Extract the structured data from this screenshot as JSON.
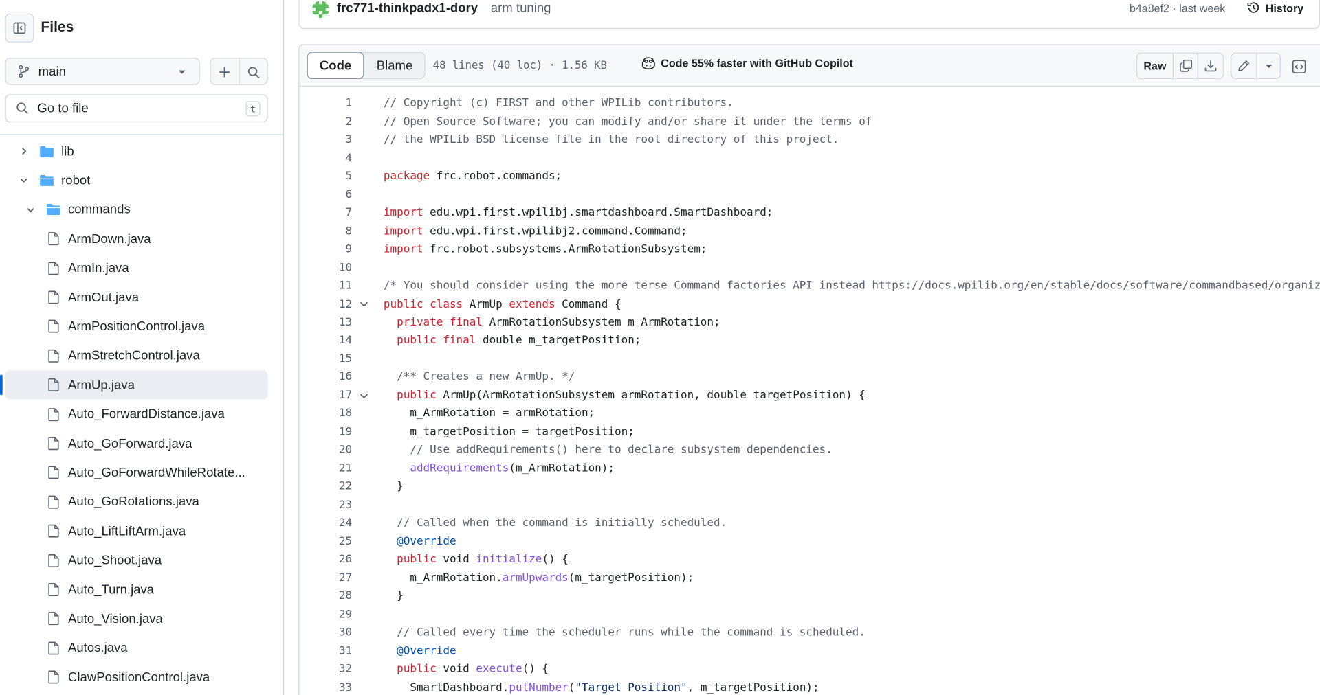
{
  "sidebar": {
    "title": "Files",
    "branch": "main",
    "search_placeholder": "Go to file",
    "search_shortcut": "t",
    "tree": [
      {
        "name": "lib",
        "type": "folder",
        "expanded": false,
        "depth": 0
      },
      {
        "name": "robot",
        "type": "folder",
        "expanded": true,
        "depth": 0
      },
      {
        "name": "commands",
        "type": "folder",
        "expanded": true,
        "depth": 1
      },
      {
        "name": "ArmDown.java",
        "type": "file",
        "depth": 2
      },
      {
        "name": "ArmIn.java",
        "type": "file",
        "depth": 2
      },
      {
        "name": "ArmOut.java",
        "type": "file",
        "depth": 2
      },
      {
        "name": "ArmPositionControl.java",
        "type": "file",
        "depth": 2
      },
      {
        "name": "ArmStretchControl.java",
        "type": "file",
        "depth": 2
      },
      {
        "name": "ArmUp.java",
        "type": "file",
        "depth": 2,
        "active": true
      },
      {
        "name": "Auto_ForwardDistance.java",
        "type": "file",
        "depth": 2
      },
      {
        "name": "Auto_GoForward.java",
        "type": "file",
        "depth": 2
      },
      {
        "name": "Auto_GoForwardWhileRotate...",
        "type": "file",
        "depth": 2
      },
      {
        "name": "Auto_GoRotations.java",
        "type": "file",
        "depth": 2
      },
      {
        "name": "Auto_LiftLiftArm.java",
        "type": "file",
        "depth": 2
      },
      {
        "name": "Auto_Shoot.java",
        "type": "file",
        "depth": 2
      },
      {
        "name": "Auto_Turn.java",
        "type": "file",
        "depth": 2
      },
      {
        "name": "Auto_Vision.java",
        "type": "file",
        "depth": 2
      },
      {
        "name": "Autos.java",
        "type": "file",
        "depth": 2
      },
      {
        "name": "ClawPositionControl.java",
        "type": "file",
        "depth": 2
      }
    ]
  },
  "commit": {
    "author": "frc771-thinkpadx1-dory",
    "message": "arm tuning",
    "hash_time": "b4a8ef2 · last week",
    "history_label": "History"
  },
  "file_header": {
    "tab_code": "Code",
    "tab_blame": "Blame",
    "meta": "48 lines (40 loc) · 1.56 KB",
    "copilot_text": "Code 55% faster with GitHub Copilot",
    "raw_label": "Raw"
  },
  "code_lines": [
    {
      "n": "1",
      "tokens": [
        [
          "cm",
          "// Copyright (c) FIRST and other WPILib contributors."
        ]
      ]
    },
    {
      "n": "2",
      "tokens": [
        [
          "cm",
          "// Open Source Software; you can modify and/or share it under the terms of"
        ]
      ]
    },
    {
      "n": "3",
      "tokens": [
        [
          "cm",
          "// the WPILib BSD license file in the root directory of this project."
        ]
      ]
    },
    {
      "n": "4",
      "tokens": []
    },
    {
      "n": "5",
      "tokens": [
        [
          "kw",
          "package"
        ],
        [
          "",
          " frc.robot.commands;"
        ]
      ]
    },
    {
      "n": "6",
      "tokens": []
    },
    {
      "n": "7",
      "tokens": [
        [
          "kw",
          "import"
        ],
        [
          "",
          " edu.wpi.first.wpilibj.smartdashboard.SmartDashboard;"
        ]
      ]
    },
    {
      "n": "8",
      "tokens": [
        [
          "kw",
          "import"
        ],
        [
          "",
          " edu.wpi.first.wpilibj2.command.Command;"
        ]
      ]
    },
    {
      "n": "9",
      "tokens": [
        [
          "kw",
          "import"
        ],
        [
          "",
          " frc.robot.subsystems.ArmRotationSubsystem;"
        ]
      ]
    },
    {
      "n": "10",
      "tokens": []
    },
    {
      "n": "11",
      "tokens": [
        [
          "cm",
          "/* You should consider using the more terse Command factories API instead https://docs.wpilib.org/en/stable/docs/software/commandbased/organizi"
        ]
      ]
    },
    {
      "n": "12",
      "fold": true,
      "tokens": [
        [
          "kw",
          "public class"
        ],
        [
          "",
          " ArmUp "
        ],
        [
          "kw",
          "extends"
        ],
        [
          "",
          " Command {"
        ]
      ]
    },
    {
      "n": "13",
      "tokens": [
        [
          "",
          "  "
        ],
        [
          "kw",
          "private final"
        ],
        [
          "",
          " ArmRotationSubsystem m_ArmRotation;"
        ]
      ]
    },
    {
      "n": "14",
      "tokens": [
        [
          "",
          "  "
        ],
        [
          "kw",
          "public final"
        ],
        [
          "",
          " double m_targetPosition;"
        ]
      ]
    },
    {
      "n": "15",
      "tokens": []
    },
    {
      "n": "16",
      "tokens": [
        [
          "",
          "  "
        ],
        [
          "cm",
          "/** Creates a new ArmUp. */"
        ]
      ]
    },
    {
      "n": "17",
      "fold": true,
      "tokens": [
        [
          "",
          "  "
        ],
        [
          "kw",
          "public"
        ],
        [
          "",
          " ArmUp(ArmRotationSubsystem armRotation, double targetPosition) {"
        ]
      ]
    },
    {
      "n": "18",
      "tokens": [
        [
          "",
          "    m_ArmRotation = armRotation;"
        ]
      ]
    },
    {
      "n": "19",
      "tokens": [
        [
          "",
          "    m_targetPosition = targetPosition;"
        ]
      ]
    },
    {
      "n": "20",
      "tokens": [
        [
          "",
          "    "
        ],
        [
          "cm",
          "// Use addRequirements() here to declare subsystem dependencies."
        ]
      ]
    },
    {
      "n": "21",
      "tokens": [
        [
          "",
          "    "
        ],
        [
          "fn",
          "addRequirements"
        ],
        [
          "",
          "(m_ArmRotation);"
        ]
      ]
    },
    {
      "n": "22",
      "tokens": [
        [
          "",
          "  }"
        ]
      ]
    },
    {
      "n": "23",
      "tokens": []
    },
    {
      "n": "24",
      "tokens": [
        [
          "",
          "  "
        ],
        [
          "cm",
          "// Called when the command is initially scheduled."
        ]
      ]
    },
    {
      "n": "25",
      "tokens": [
        [
          "",
          "  "
        ],
        [
          "an",
          "@Override"
        ]
      ]
    },
    {
      "n": "26",
      "tokens": [
        [
          "",
          "  "
        ],
        [
          "kw",
          "public"
        ],
        [
          "",
          " void "
        ],
        [
          "fn",
          "initialize"
        ],
        [
          "",
          "() {"
        ]
      ]
    },
    {
      "n": "27",
      "tokens": [
        [
          "",
          "    m_ArmRotation."
        ],
        [
          "fn",
          "armUpwards"
        ],
        [
          "",
          "(m_targetPosition);"
        ]
      ]
    },
    {
      "n": "28",
      "tokens": [
        [
          "",
          "  }"
        ]
      ]
    },
    {
      "n": "29",
      "tokens": []
    },
    {
      "n": "30",
      "tokens": [
        [
          "",
          "  "
        ],
        [
          "cm",
          "// Called every time the scheduler runs while the command is scheduled."
        ]
      ]
    },
    {
      "n": "31",
      "tokens": [
        [
          "",
          "  "
        ],
        [
          "an",
          "@Override"
        ]
      ]
    },
    {
      "n": "32",
      "tokens": [
        [
          "",
          "  "
        ],
        [
          "kw",
          "public"
        ],
        [
          "",
          " void "
        ],
        [
          "fn",
          "execute"
        ],
        [
          "",
          "() {"
        ]
      ]
    },
    {
      "n": "33",
      "tokens": [
        [
          "",
          "    SmartDashboard."
        ],
        [
          "fn",
          "putNumber"
        ],
        [
          "",
          "("
        ],
        [
          "st",
          "\"Target Position\""
        ],
        [
          "",
          ", m_targetPosition);"
        ]
      ]
    }
  ],
  "colors": {
    "keyword": "#cf222e",
    "comment": "#59636e",
    "function": "#8250df",
    "annotation": "#0550ae",
    "string": "#0a3069",
    "folder": "#54aeff",
    "active_bar": "#0969da"
  }
}
